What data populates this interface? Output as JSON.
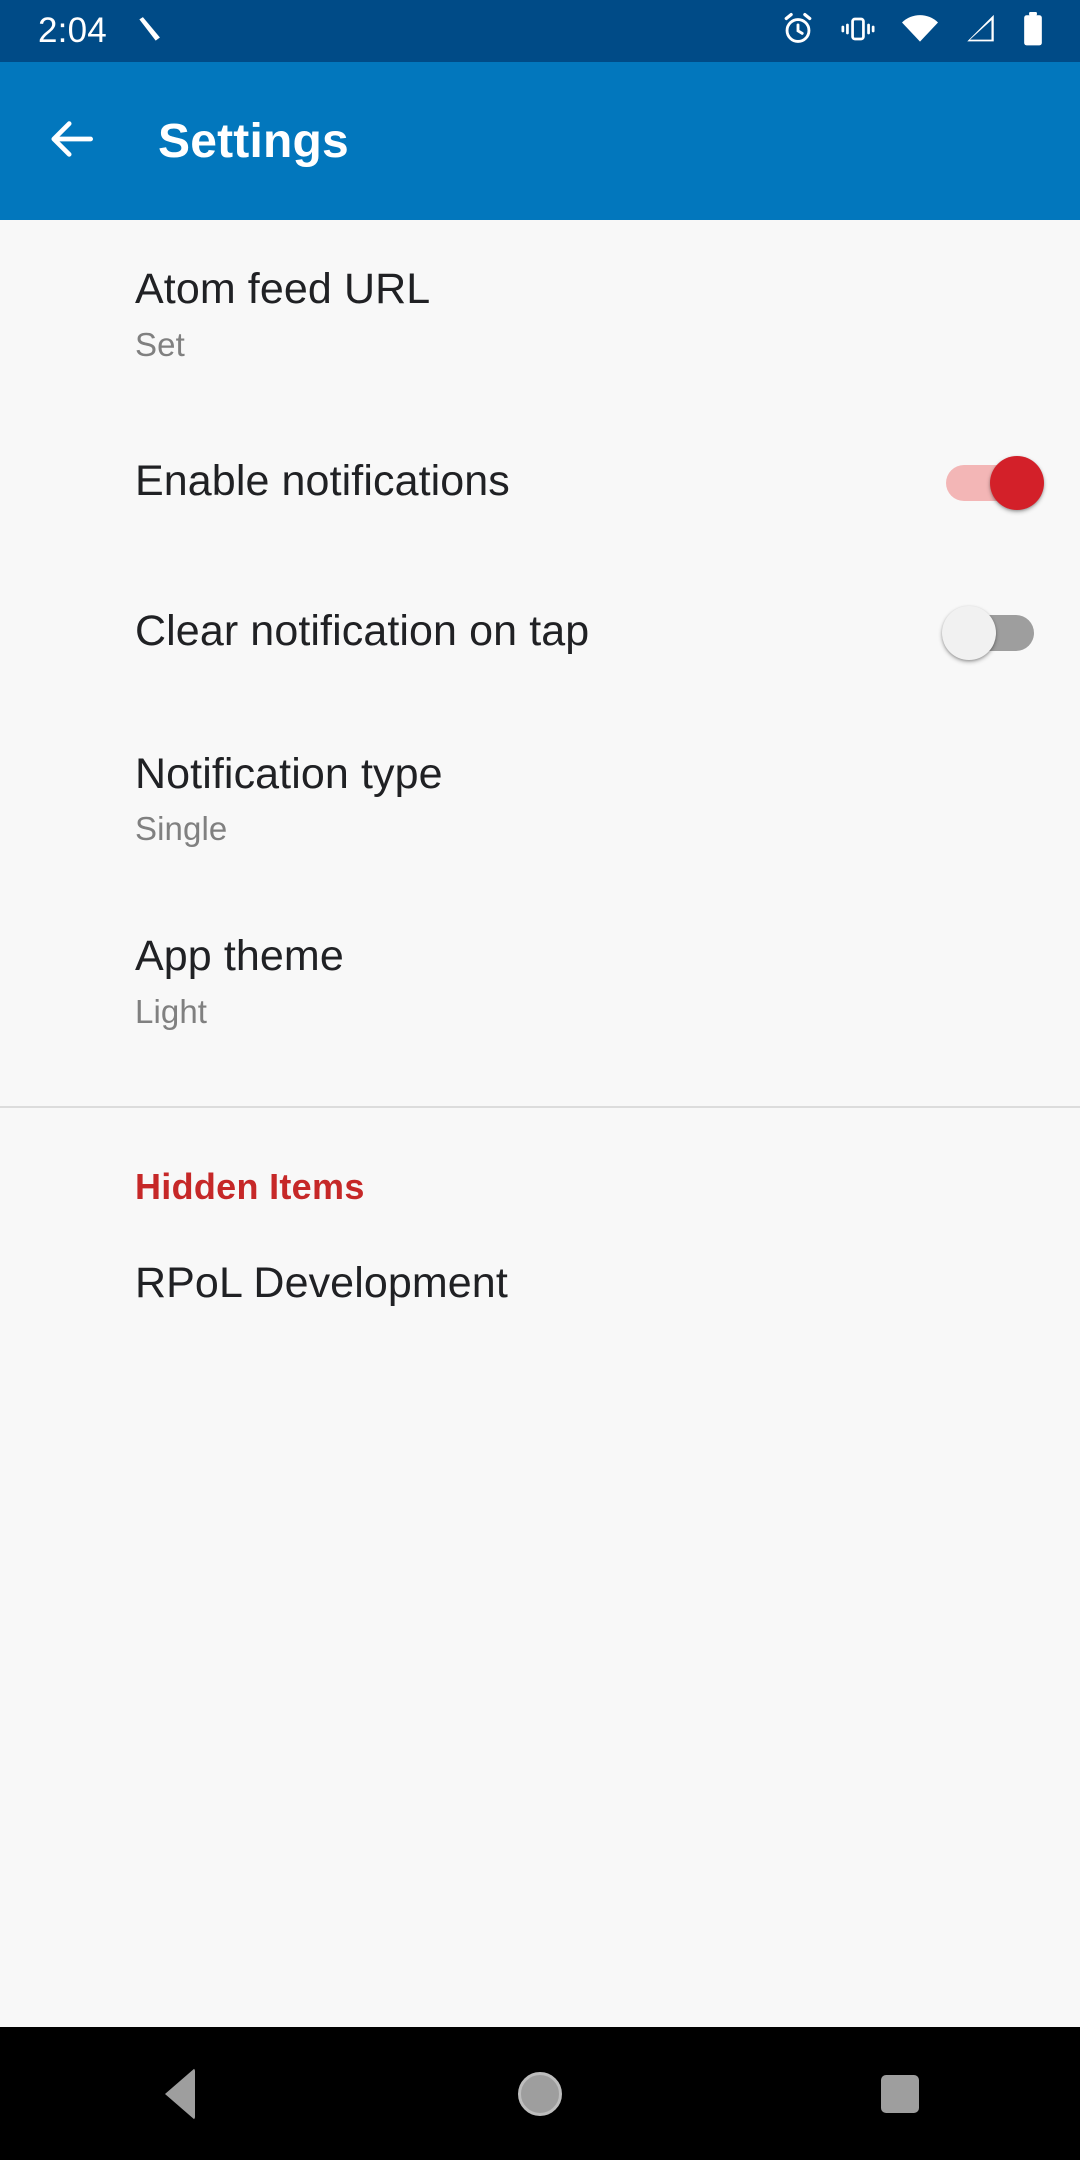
{
  "status_bar": {
    "time": "2:04",
    "left_icons": [
      {
        "name": "stylus-icon"
      }
    ],
    "right_icons": [
      {
        "name": "alarm-icon"
      },
      {
        "name": "vibrate-icon"
      },
      {
        "name": "wifi-icon"
      },
      {
        "name": "cellular-signal-icon"
      },
      {
        "name": "battery-icon"
      }
    ],
    "background_color": "#004B87",
    "foreground_color": "#FFFFFF"
  },
  "app_bar": {
    "title": "Settings",
    "back_label": "Navigate up",
    "background_color": "#0277BD",
    "foreground_color": "#FFFFFF"
  },
  "preferences": [
    {
      "title": "Atom feed URL",
      "summary": "Set"
    },
    {
      "title": "Enable notifications",
      "switch": "on"
    },
    {
      "title": "Clear notification on tap",
      "switch": "off"
    },
    {
      "title": "Notification type",
      "summary": "Single"
    },
    {
      "title": "App theme",
      "summary": "Light"
    }
  ],
  "category": {
    "header": "Hidden Items",
    "header_color": "#C62828",
    "items": [
      {
        "title": "RPoL Development"
      }
    ]
  },
  "colors": {
    "accent": "#D32029",
    "content_background": "#F8F8F8",
    "title_text": "#202124",
    "summary_text": "#808080",
    "divider": "#DCDCDC",
    "nav_bar_background": "#000000",
    "nav_icon": "#9E9E9E"
  },
  "nav_bar": {
    "back_label": "Back",
    "home_label": "Home",
    "recents_label": "Recents"
  }
}
